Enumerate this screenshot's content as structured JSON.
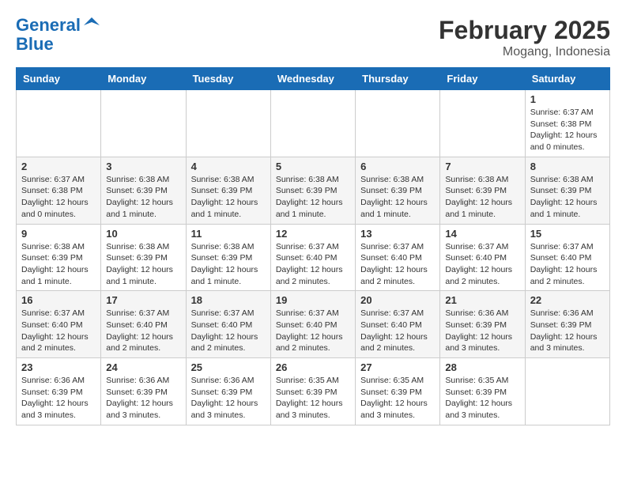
{
  "logo": {
    "line1": "General",
    "line2": "Blue"
  },
  "title": "February 2025",
  "location": "Mogang, Indonesia",
  "days_of_week": [
    "Sunday",
    "Monday",
    "Tuesday",
    "Wednesday",
    "Thursday",
    "Friday",
    "Saturday"
  ],
  "weeks": [
    [
      {
        "day": "",
        "info": ""
      },
      {
        "day": "",
        "info": ""
      },
      {
        "day": "",
        "info": ""
      },
      {
        "day": "",
        "info": ""
      },
      {
        "day": "",
        "info": ""
      },
      {
        "day": "",
        "info": ""
      },
      {
        "day": "1",
        "info": "Sunrise: 6:37 AM\nSunset: 6:38 PM\nDaylight: 12 hours\nand 0 minutes."
      }
    ],
    [
      {
        "day": "2",
        "info": "Sunrise: 6:37 AM\nSunset: 6:38 PM\nDaylight: 12 hours\nand 0 minutes."
      },
      {
        "day": "3",
        "info": "Sunrise: 6:38 AM\nSunset: 6:39 PM\nDaylight: 12 hours\nand 1 minute."
      },
      {
        "day": "4",
        "info": "Sunrise: 6:38 AM\nSunset: 6:39 PM\nDaylight: 12 hours\nand 1 minute."
      },
      {
        "day": "5",
        "info": "Sunrise: 6:38 AM\nSunset: 6:39 PM\nDaylight: 12 hours\nand 1 minute."
      },
      {
        "day": "6",
        "info": "Sunrise: 6:38 AM\nSunset: 6:39 PM\nDaylight: 12 hours\nand 1 minute."
      },
      {
        "day": "7",
        "info": "Sunrise: 6:38 AM\nSunset: 6:39 PM\nDaylight: 12 hours\nand 1 minute."
      },
      {
        "day": "8",
        "info": "Sunrise: 6:38 AM\nSunset: 6:39 PM\nDaylight: 12 hours\nand 1 minute."
      }
    ],
    [
      {
        "day": "9",
        "info": "Sunrise: 6:38 AM\nSunset: 6:39 PM\nDaylight: 12 hours\nand 1 minute."
      },
      {
        "day": "10",
        "info": "Sunrise: 6:38 AM\nSunset: 6:39 PM\nDaylight: 12 hours\nand 1 minute."
      },
      {
        "day": "11",
        "info": "Sunrise: 6:38 AM\nSunset: 6:39 PM\nDaylight: 12 hours\nand 1 minute."
      },
      {
        "day": "12",
        "info": "Sunrise: 6:37 AM\nSunset: 6:40 PM\nDaylight: 12 hours\nand 2 minutes."
      },
      {
        "day": "13",
        "info": "Sunrise: 6:37 AM\nSunset: 6:40 PM\nDaylight: 12 hours\nand 2 minutes."
      },
      {
        "day": "14",
        "info": "Sunrise: 6:37 AM\nSunset: 6:40 PM\nDaylight: 12 hours\nand 2 minutes."
      },
      {
        "day": "15",
        "info": "Sunrise: 6:37 AM\nSunset: 6:40 PM\nDaylight: 12 hours\nand 2 minutes."
      }
    ],
    [
      {
        "day": "16",
        "info": "Sunrise: 6:37 AM\nSunset: 6:40 PM\nDaylight: 12 hours\nand 2 minutes."
      },
      {
        "day": "17",
        "info": "Sunrise: 6:37 AM\nSunset: 6:40 PM\nDaylight: 12 hours\nand 2 minutes."
      },
      {
        "day": "18",
        "info": "Sunrise: 6:37 AM\nSunset: 6:40 PM\nDaylight: 12 hours\nand 2 minutes."
      },
      {
        "day": "19",
        "info": "Sunrise: 6:37 AM\nSunset: 6:40 PM\nDaylight: 12 hours\nand 2 minutes."
      },
      {
        "day": "20",
        "info": "Sunrise: 6:37 AM\nSunset: 6:40 PM\nDaylight: 12 hours\nand 2 minutes."
      },
      {
        "day": "21",
        "info": "Sunrise: 6:36 AM\nSunset: 6:39 PM\nDaylight: 12 hours\nand 3 minutes."
      },
      {
        "day": "22",
        "info": "Sunrise: 6:36 AM\nSunset: 6:39 PM\nDaylight: 12 hours\nand 3 minutes."
      }
    ],
    [
      {
        "day": "23",
        "info": "Sunrise: 6:36 AM\nSunset: 6:39 PM\nDaylight: 12 hours\nand 3 minutes."
      },
      {
        "day": "24",
        "info": "Sunrise: 6:36 AM\nSunset: 6:39 PM\nDaylight: 12 hours\nand 3 minutes."
      },
      {
        "day": "25",
        "info": "Sunrise: 6:36 AM\nSunset: 6:39 PM\nDaylight: 12 hours\nand 3 minutes."
      },
      {
        "day": "26",
        "info": "Sunrise: 6:35 AM\nSunset: 6:39 PM\nDaylight: 12 hours\nand 3 minutes."
      },
      {
        "day": "27",
        "info": "Sunrise: 6:35 AM\nSunset: 6:39 PM\nDaylight: 12 hours\nand 3 minutes."
      },
      {
        "day": "28",
        "info": "Sunrise: 6:35 AM\nSunset: 6:39 PM\nDaylight: 12 hours\nand 3 minutes."
      },
      {
        "day": "",
        "info": ""
      }
    ]
  ]
}
